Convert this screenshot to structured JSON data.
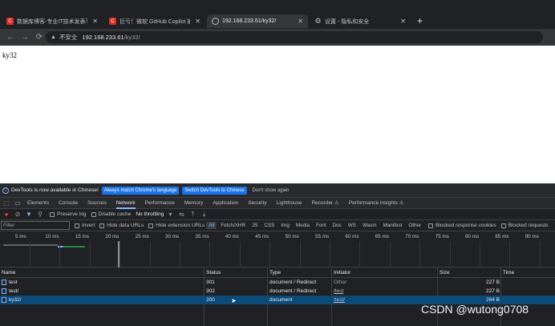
{
  "browser": {
    "tabs": [
      {
        "icon": "csdn-favicon-icon",
        "title": "数据库博客-专业IT技术发表平台",
        "active": false
      },
      {
        "icon": "csdn-favicon-icon",
        "title": "巨亏！微软 GitHub Copilot 被",
        "active": false
      },
      {
        "icon": "globe-icon",
        "title": "192.168.233.61/ky32/",
        "active": true
      },
      {
        "icon": "gear-icon",
        "title": "设置 - 隐私和安全",
        "active": false
      }
    ],
    "new_tab": "+",
    "address": {
      "security_label": "不安全",
      "host": "192.168.233.61",
      "path": "/ky32/"
    }
  },
  "page": {
    "text": "ky32"
  },
  "devtools": {
    "infobar": {
      "message": "DevTools is now available in Chinese!",
      "match_button": "Always match Chrome's language",
      "switch_button": "Switch DevTools to Chinese",
      "dismiss": "Don't show again"
    },
    "tabs": [
      "Elements",
      "Console",
      "Sources",
      "Network",
      "Performance",
      "Memory",
      "Application",
      "Security",
      "Lighthouse",
      "Recorder ⚠",
      "Performance insights ⚠"
    ],
    "active_tab": "Network",
    "toolbar": {
      "preserve_log": "Preserve log",
      "disable_cache": "Disable cache",
      "throttling": "No throttling"
    },
    "filter": {
      "placeholder": "Filter",
      "invert": "Invert",
      "hide_data_urls": "Hide data URLs",
      "hide_extension_urls": "Hide extension URLs",
      "types": [
        "All",
        "Fetch/XHR",
        "JS",
        "CSS",
        "Img",
        "Media",
        "Font",
        "Doc",
        "WS",
        "Wasm",
        "Manifest",
        "Other"
      ],
      "blocked_cookies": "Blocked response cookies",
      "blocked_requests": "Blocked requests"
    },
    "timeline_ticks": [
      "5 ms",
      "10 ms",
      "15 ms",
      "20 ms",
      "25 ms",
      "30 ms",
      "35 ms",
      "40 ms",
      "45 ms",
      "50 ms",
      "55 ms",
      "60 ms",
      "65 ms",
      "70 ms",
      "75 ms",
      "80 ms",
      "85 ms",
      "90 ms"
    ],
    "columns": [
      "Name",
      "Status",
      "Type",
      "Initiator",
      "Size",
      "Time"
    ],
    "requests": [
      {
        "name": "test",
        "status": "301",
        "type": "document / Redirect",
        "initiator": "Other",
        "size": "227 B",
        "selected": false
      },
      {
        "name": "test/",
        "status": "302",
        "type": "document / Redirect",
        "initiator": "/test",
        "size": "227 B",
        "selected": false
      },
      {
        "name": "ky32/",
        "status": "200",
        "type": "document",
        "initiator": "/test/",
        "size": "264 B",
        "selected": true
      }
    ]
  },
  "watermark": "CSDN @wutong0708"
}
